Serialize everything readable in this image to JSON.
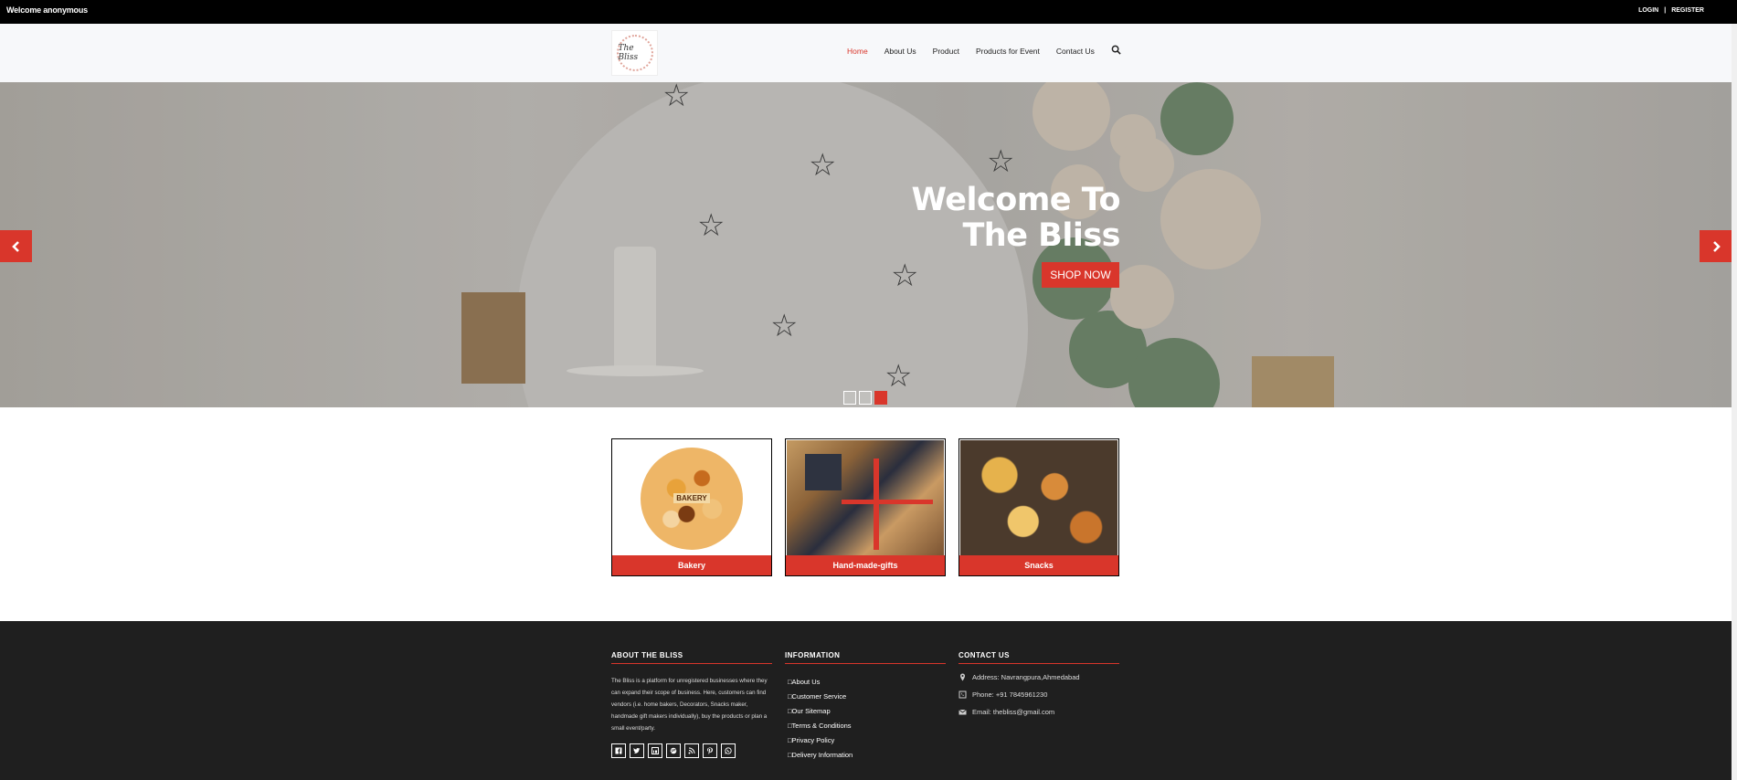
{
  "topbar": {
    "welcome": "Welcome anonymous",
    "login": "LOGIN",
    "separator": "|",
    "register": "REGISTER"
  },
  "header": {
    "logo_text": "The Bliss"
  },
  "nav": [
    {
      "label": "Home",
      "active": true
    },
    {
      "label": "About Us",
      "active": false
    },
    {
      "label": "Product",
      "active": false
    },
    {
      "label": "Products for Event",
      "active": false
    },
    {
      "label": "Contact Us",
      "active": false
    }
  ],
  "hero": {
    "title_line1": "Welcome To",
    "title_line2": "The Bliss",
    "button": "SHOP NOW",
    "active_slide": 3,
    "slide_count": 3
  },
  "categories": [
    {
      "label": "Bakery",
      "image_text": "BAKERY"
    },
    {
      "label": "Hand-made-gifts"
    },
    {
      "label": "Snacks"
    }
  ],
  "footer": {
    "about": {
      "heading": "ABOUT THE BLISS",
      "text": "The Bliss is a platform for unregistered businesses where they can expand their scope of business. Here, customers can find vendors (i.e. home bakers, Decorators, Snacks maker, handmade gift makers individually), buy the products or plan a small event/party."
    },
    "information": {
      "heading": "INFORMATION",
      "items": [
        "About Us",
        "Customer Service",
        "Our Sitemap",
        "Terms & Conditions",
        "Privacy Policy",
        "Delivery Information"
      ]
    },
    "contact": {
      "heading": "CONTACT US",
      "address": "Address: Navrangpura,Ahmedabad",
      "phone": "Phone: +91 7845961230",
      "email": "Email: thebliss@gmail.com"
    }
  },
  "colors": {
    "accent": "#d9362b",
    "topbar": "#000000",
    "footer": "#1f1f1f"
  },
  "icons": [
    "search-icon",
    "chevron-left-icon",
    "chevron-right-icon",
    "facebook-icon",
    "twitter-icon",
    "linkedin-icon",
    "dribbble-icon",
    "rss-icon",
    "pinterest-icon",
    "whatsapp-icon",
    "map-pin-icon",
    "phone-icon",
    "envelope-icon"
  ]
}
